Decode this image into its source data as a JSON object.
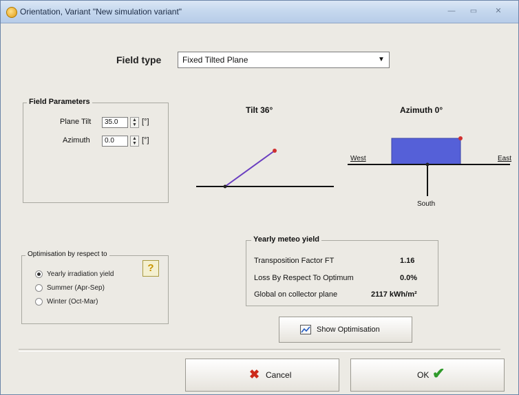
{
  "window": {
    "title": "Orientation, Variant \"New simulation variant\"",
    "controls": [
      "—",
      "▭",
      "✕"
    ]
  },
  "field_type": {
    "label": "Field type",
    "value": "Fixed Tilted Plane",
    "arrow": "▼"
  },
  "field_parameters": {
    "title": "Field Parameters",
    "plane_tilt_label": "Plane Tilt",
    "plane_tilt_value": "35.0",
    "azimuth_label": "Azimuth",
    "azimuth_value": "0.0",
    "unit": "[°]"
  },
  "diagrams": {
    "tilt_title": "Tilt 36°",
    "azimuth_title": "Azimuth 0°",
    "west_label": "West",
    "east_label": "East",
    "south_label": "South",
    "plane_color": "#5560d8",
    "pivot_color": "#d03030",
    "tilt_line_color": "#6a3ec0"
  },
  "optimisation": {
    "title": "Optimisation by respect to",
    "options": [
      {
        "label": "Yearly irradiation yield",
        "selected": true
      },
      {
        "label": "Summer (Apr-Sep)",
        "selected": false
      },
      {
        "label": "Winter (Oct-Mar)",
        "selected": false
      }
    ],
    "help_icon_glyph": "?"
  },
  "meteo_yield": {
    "title": "Yearly meteo yield",
    "rows": [
      {
        "label": "Transposition Factor FT",
        "value": "1.16"
      },
      {
        "label": "Loss By Respect To Optimum",
        "value": "0.0%"
      },
      {
        "label": "Global on collector plane",
        "value": "2117 kWh/m²"
      }
    ]
  },
  "buttons": {
    "show_optimisation": "Show Optimisation",
    "cancel": "Cancel",
    "ok": "OK",
    "cancel_icon_color": "#cc2a1a",
    "ok_icon_color": "#2f9a2a"
  }
}
